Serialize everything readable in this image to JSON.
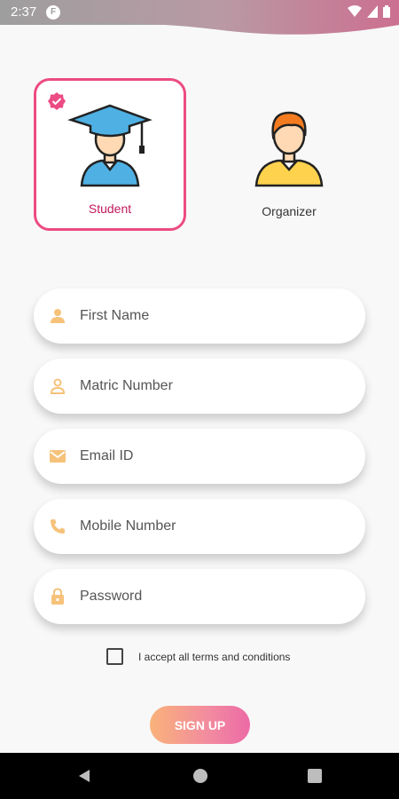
{
  "status_bar": {
    "time": "2:37",
    "app_icon": "F"
  },
  "roles": [
    {
      "label": "Student",
      "selected": true,
      "icon": "graduate-icon"
    },
    {
      "label": "Organizer",
      "selected": false,
      "icon": "organizer-icon"
    }
  ],
  "form": {
    "first_name": {
      "placeholder": "First Name",
      "icon": "person-icon"
    },
    "matric_number": {
      "placeholder": "Matric Number",
      "icon": "person-outline-icon"
    },
    "email": {
      "placeholder": "Email ID",
      "icon": "mail-icon"
    },
    "mobile": {
      "placeholder": "Mobile Number",
      "icon": "phone-icon"
    },
    "password": {
      "placeholder": "Password",
      "icon": "lock-icon"
    }
  },
  "terms": {
    "label": "I accept all terms and conditions",
    "checked": false
  },
  "signup": {
    "label": "SIGN UP"
  },
  "colors": {
    "accent": "#ec4b83",
    "icon": "#f6c27a",
    "button_start": "#f9b27a",
    "button_end": "#ec6aa6"
  }
}
